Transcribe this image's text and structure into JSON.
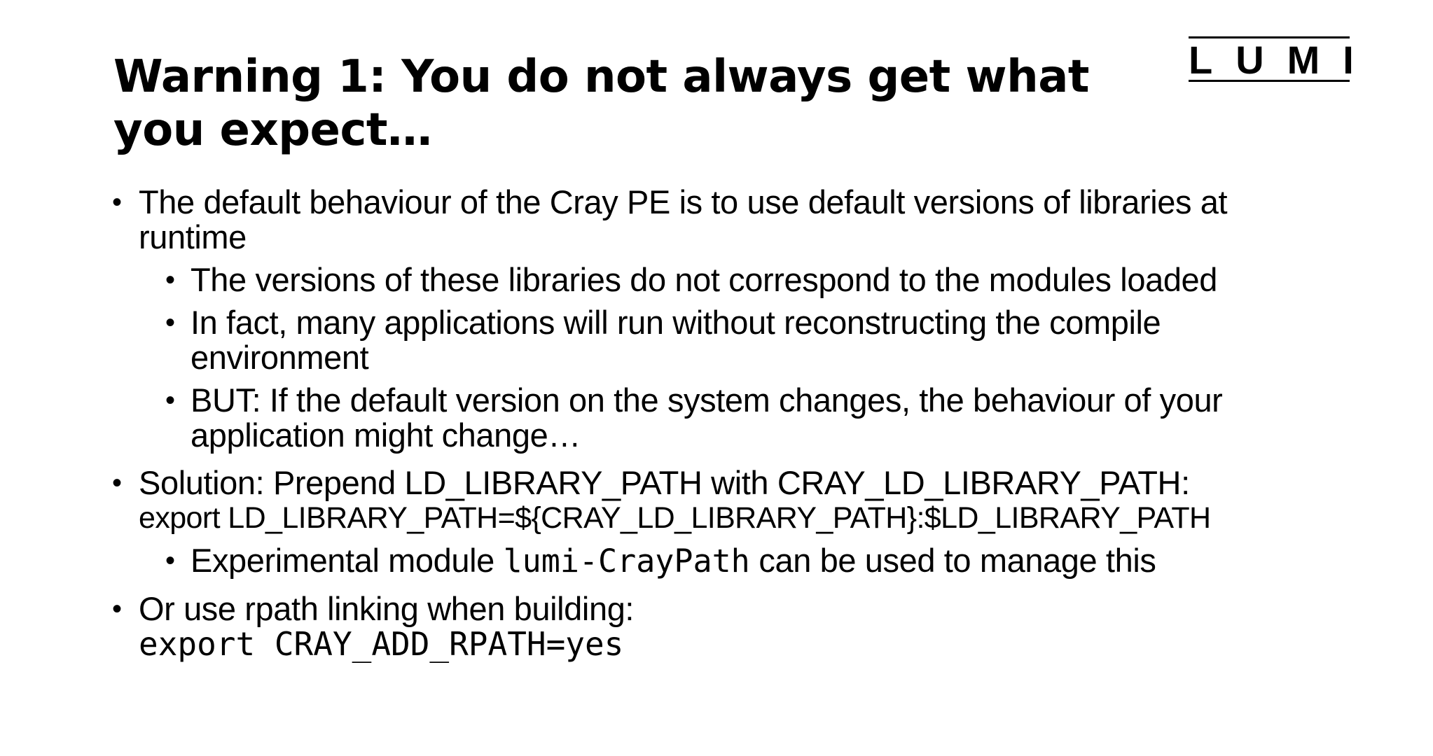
{
  "slide": {
    "title": "Warning 1: You do not always get what you expect…",
    "logo_text": "LUMI"
  },
  "bullets": {
    "b1": "The default behaviour of the Cray PE is to use default versions of libraries at runtime",
    "b1_1": "The versions of these libraries do not correspond to the modules loaded",
    "b1_2": "In fact, many applications will run without reconstructing the compile environment",
    "b1_3": "BUT: If the default version on the system changes, the behaviour of your application might change…",
    "b2": "Solution: Prepend LD_LIBRARY_PATH with CRAY_LD_LIBRARY_PATH:",
    "b2_cmd": "export LD_LIBRARY_PATH=${CRAY_LD_LIBRARY_PATH}:$LD_LIBRARY_PATH",
    "b2_1_pre": "Experimental module ",
    "b2_1_code": "lumi-CrayPath",
    "b2_1_post": " can be used to manage this",
    "b3": "Or use rpath linking when building:",
    "b3_cmd": "export CRAY_ADD_RPATH=yes"
  },
  "bullet_glyph": "•"
}
